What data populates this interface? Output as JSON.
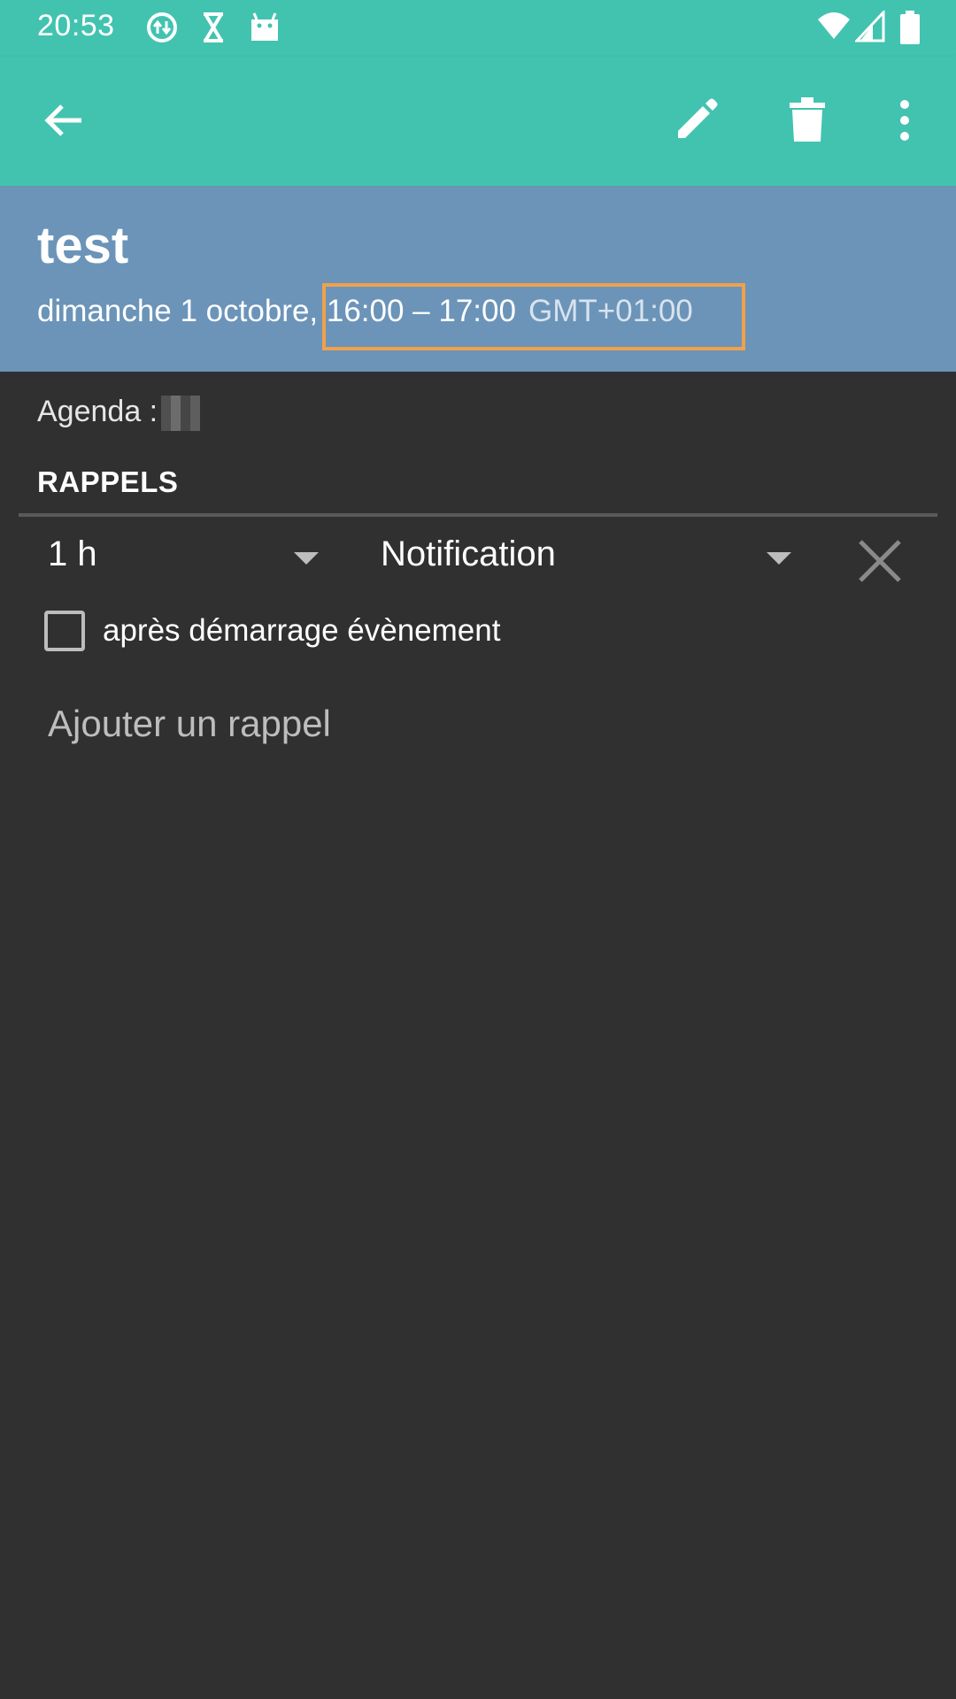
{
  "status_bar": {
    "time": "20:53",
    "left_icons": [
      "sync-icon",
      "hourglass-icon",
      "android-icon"
    ],
    "right_icons": [
      "wifi-icon",
      "signal-icon",
      "battery-icon"
    ]
  },
  "toolbar": {
    "back_icon": "back-arrow-icon",
    "actions": [
      "edit-icon",
      "delete-icon",
      "more-options-icon"
    ],
    "color": "#42c3b0"
  },
  "event": {
    "title": "test",
    "date": "dimanche 1 octobre",
    "time_range": "16:00 – 17:00",
    "timezone": "GMT+01:00",
    "header_color": "#6b94b8"
  },
  "agenda": {
    "label": "Agenda :"
  },
  "reminders": {
    "section_title": "RAPPELS",
    "items": [
      {
        "time": "1 h",
        "method": "Notification",
        "after_start_label": "après démarrage évènement",
        "after_start_checked": false
      }
    ],
    "add_label": "Ajouter un rappel"
  },
  "colors": {
    "background": "#303030",
    "highlight": "#f0a14a"
  }
}
